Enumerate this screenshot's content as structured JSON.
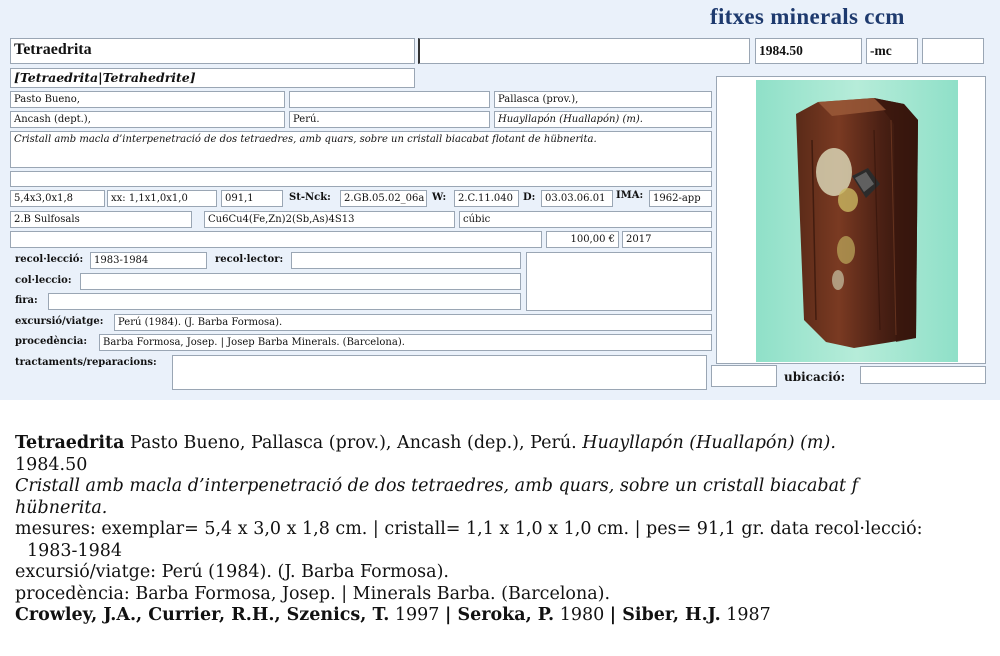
{
  "app": {
    "title": "fitxes minerals ccm"
  },
  "header": {
    "name": "Tetraedrita",
    "blank_field": "",
    "catalog_number": "1984.50",
    "catalog_suffix": "-mc",
    "extra_field": ""
  },
  "species": "[Tetraedrita|Tetrahedrite]",
  "locality": {
    "row1": [
      "Pasto Bueno,",
      "",
      "Pallasca (prov.),"
    ],
    "row2": [
      "Ancash (dept.),",
      "Perú.",
      "Huayllapón (Huallapón) (m)."
    ]
  },
  "description": "Cristall amb macla d’interpenetració de dos tetraedres, amb quars, sobre un cristall biacabat flotant de hübnerita.",
  "notes_blank": "",
  "measures": {
    "specimen": "5,4x3,0x1,8",
    "crystal": "xx: 1,1x1,0x1,0",
    "weight": "091,1",
    "strunz_label": "St-Nck:",
    "strunz": "2.GB.05.02_06a",
    "w_label": "W:",
    "w": "2.C.11.040",
    "d_label": "D:",
    "d": "03.03.06.01",
    "ima_label": "IMA:",
    "ima": "1962-app"
  },
  "classification": {
    "class": "2.B Sulfosals",
    "formula": "Cu6Cu4(Fe,Zn)2(Sb,As)4S13",
    "system": "cúbic"
  },
  "price": {
    "blank": "",
    "value": "100,00 €",
    "year": "2017"
  },
  "collection": {
    "recollection_label": "recol·lecció:",
    "recollection": "1983-1984",
    "collector_label": "recol·lector:",
    "collector": "",
    "colleccio_label": "col·leccio:",
    "colleccio": "",
    "fira_label": "fira:",
    "fira": "",
    "excursio_label": "excursió/viatge:",
    "excursio": "Perú (1984). (J. Barba Formosa).",
    "procedencia_label": "procedència:",
    "procedencia": "Barba Formosa, Josep. | Josep Barba Minerals. (Barcelona).",
    "tractaments_label": "tractaments/reparacions:",
    "tractaments": "",
    "ubicacio_label": "ubicació:",
    "ubicacio": ""
  },
  "summary": {
    "name": "Tetraedrita",
    "locality_plain": " Pasto Bueno, Pallasca (prov.), Ancash (dep.), Perú. ",
    "locality_italic": "Huayllapón (Huallapón) (m).",
    "catalog": "1984.50",
    "desc_line1": "Cristall amb macla d’interpenetració de dos tetraedres, amb quars, sobre un cristall biacabat f",
    "desc_line2": "hübnerita.",
    "measures_line1": "mesures: exemplar= 5,4 x 3,0 x 1,8 cm. | cristall= 1,1 x 1,0 x 1,0 cm. | pes= 91,1 gr. data recol·lecció:",
    "measures_line2": "1983-1984",
    "excursio": "excursió/viatge: Perú (1984). (J. Barba Formosa).",
    "procedencia": "procedència: Barba Formosa, Josep. | Minerals Barba. (Barcelona).",
    "refs": [
      {
        "author": "Crowley, J.A., Currier, R.H., Szenics, T.",
        "year": " 1997 "
      },
      {
        "sep": "| "
      },
      {
        "author": "Seroka, P.",
        "year": " 1980 "
      },
      {
        "sep": "| "
      },
      {
        "author": "Siber, H.J.",
        "year": " 1987"
      }
    ]
  }
}
